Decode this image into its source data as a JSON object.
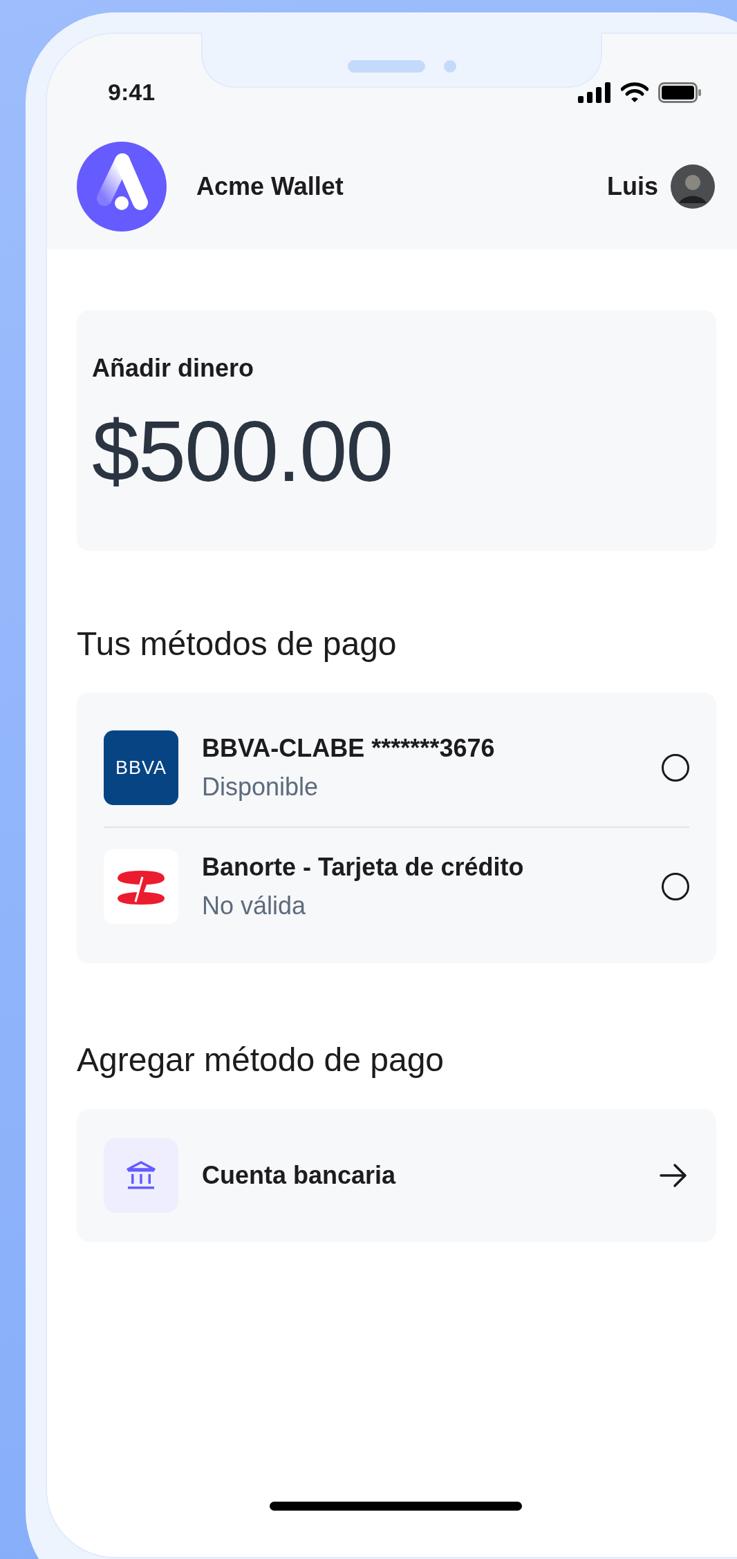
{
  "status_bar": {
    "time": "9:41"
  },
  "header": {
    "app_name": "Acme Wallet",
    "user_name": "Luis"
  },
  "amount_card": {
    "label": "Añadir dinero",
    "amount": "$500.00"
  },
  "payment_methods": {
    "title": "Tus métodos de pago",
    "items": [
      {
        "kind": "bbva",
        "logo_text": "BBVA",
        "name": "BBVA-CLABE *******3676",
        "status": "Disponible",
        "selected": false
      },
      {
        "kind": "banorte",
        "name": "Banorte - Tarjeta de crédito",
        "status": "No válida",
        "selected": false
      }
    ]
  },
  "add_method": {
    "title": "Agregar método de pago",
    "items": [
      {
        "kind": "bank",
        "label": "Cuenta bancaria"
      }
    ]
  }
}
